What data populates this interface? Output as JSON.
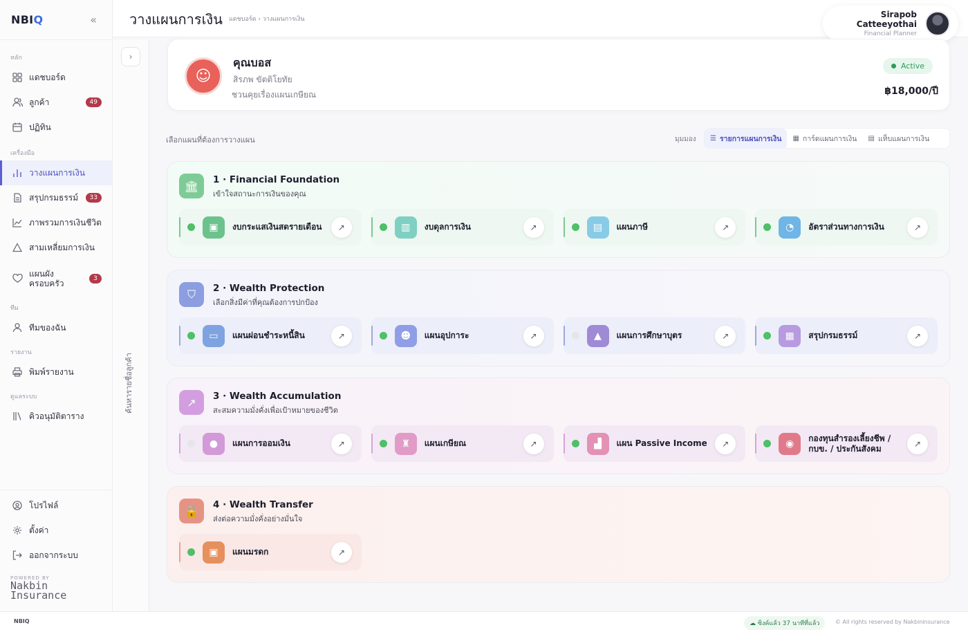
{
  "app": {
    "logo_main": "NBI",
    "logo_accent": "Q",
    "collapse_icon": "«"
  },
  "sidebar": {
    "sections": {
      "main": "หลัก",
      "tools": "เครื่องมือ",
      "team": "ทีม",
      "report": "รายงาน",
      "admin": "ดูแลระบบ"
    },
    "items": [
      {
        "label": "แดชบอร์ด",
        "icon": "grid-icon"
      },
      {
        "label": "ลูกค้า",
        "icon": "users-icon",
        "badge": "49"
      },
      {
        "label": "ปฏิทิน",
        "icon": "calendar-icon"
      },
      {
        "label": "วางแผนการเงิน",
        "icon": "bar-chart-icon"
      },
      {
        "label": "สรุปกรมธรรม์",
        "icon": "document-icon",
        "badge": "33"
      },
      {
        "label": "ภาพรวมการเงินชีวิต",
        "icon": "line-chart-icon"
      },
      {
        "label": "สามเหลี่ยมการเงิน",
        "icon": "triangle-icon"
      },
      {
        "label": "แผนผัง\nครอบครัว",
        "icon": "heart-hands-icon",
        "badge": "3"
      },
      {
        "label": "ทีมของฉัน",
        "icon": "user-icon"
      },
      {
        "label": "พิมพ์รายงาน",
        "icon": "printer-icon"
      },
      {
        "label": "คิวอนุมัติตาราง",
        "icon": "library-icon"
      }
    ],
    "bottom": [
      {
        "label": "โปรไฟล์",
        "icon": "profile-icon"
      },
      {
        "label": "ตั้งค่า",
        "icon": "gear-icon"
      },
      {
        "label": "ออกจากระบบ",
        "icon": "logout-icon"
      }
    ],
    "powered_by": "POWERED BY",
    "powered_brand": "Nakbin\nInsurance"
  },
  "strip": {
    "expand_icon": "›",
    "search_label": "ค้นหารายชื่อลูกค้า"
  },
  "header": {
    "title": "วางแผนการเงิน",
    "breadcrumb": "แดชบอร์ด › วางแผนการเงิน",
    "user_name": "Sirapob Catteeyothai",
    "user_role": "Financial Planner"
  },
  "client": {
    "name": "คุณบอส",
    "fullname": "สิรภพ ขัตติโยทัย",
    "note": "ชวนคุยเรื่องแผนเกษียณ",
    "status": "Active",
    "fee": "฿18,000/ปี"
  },
  "planner": {
    "select_label": "เลือกแผนที่ต้องการวางแผน",
    "view_label": "มุมมอง",
    "views": [
      "รายการแผนการเงิน",
      "การ์ดแผนการเงิน",
      "แท็บแผนการเงิน"
    ]
  },
  "sections": [
    {
      "title": "1 · Financial Foundation",
      "subtitle": "เข้าใจสถานะการเงินของคุณ",
      "icon": "bank-icon",
      "color": "#7fcb98",
      "plans": [
        {
          "label": "งบกระแสเงินสดรายเดือน",
          "active": true,
          "icon": "wallet-icon",
          "color": "#6cc28c"
        },
        {
          "label": "งบดุลการเงิน",
          "active": true,
          "icon": "balance-icon",
          "color": "#7fd0c2"
        },
        {
          "label": "แผนภาษี",
          "active": true,
          "icon": "tax-doc-icon",
          "color": "#88cbe6"
        },
        {
          "label": "อัตราส่วนทางการเงิน",
          "active": true,
          "icon": "pie-icon",
          "color": "#6fb5e6"
        }
      ]
    },
    {
      "title": "2 · Wealth Protection",
      "subtitle": "เลือกสิ่งมีค่าที่คุณต้องการปกป้อง",
      "icon": "shield-icon",
      "color": "#8c9ee0",
      "plans": [
        {
          "label": "แผนผ่อนชำระหนี้สิน",
          "active": true,
          "icon": "card-icon",
          "color": "#7fa3e0"
        },
        {
          "label": "แผนอุปการะ",
          "active": true,
          "icon": "family-icon",
          "color": "#8f9ee6"
        },
        {
          "label": "แผนการศึกษาบุตร",
          "active": false,
          "icon": "graduation-icon",
          "color": "#9f8ad6"
        },
        {
          "label": "สรุปกรมธรรม์",
          "active": true,
          "icon": "clipboard-icon",
          "color": "#b79ae0"
        }
      ]
    },
    {
      "title": "3 · Wealth Accumulation",
      "subtitle": "สะสมความมั่งคั่งเพื่อเป้าหมายของชีวิต",
      "icon": "trend-up-icon",
      "color": "#d39ee0",
      "plans": [
        {
          "label": "แผนการออมเงิน",
          "active": false,
          "icon": "piggy-icon",
          "color": "#d29ad8"
        },
        {
          "label": "แผนเกษียณ",
          "active": true,
          "icon": "chair-icon",
          "color": "#e29bc6"
        },
        {
          "label": "แผน Passive Income",
          "active": true,
          "icon": "growth-chart-icon",
          "color": "#e491b6"
        },
        {
          "label": "กองทุนสำรองเลี้ยงชีพ / กบข. / ประกันสังคม",
          "active": true,
          "icon": "coin-stack-icon",
          "color": "#e07a8a"
        }
      ]
    },
    {
      "title": "4 · Wealth Transfer",
      "subtitle": "ส่งต่อความมั่งคั่งอย่างมั่นใจ",
      "icon": "lock-icon",
      "color": "#e59484",
      "plans": [
        {
          "label": "แผนมรดก",
          "active": true,
          "icon": "safe-icon",
          "color": "#e6905e"
        }
      ]
    }
  ],
  "footer": {
    "brand": "NBIQ",
    "sync": "ซิงค์แล้ว 37 นาทีที่แล้ว",
    "copyright": "© All rights reserved by Nakbininsurance"
  }
}
